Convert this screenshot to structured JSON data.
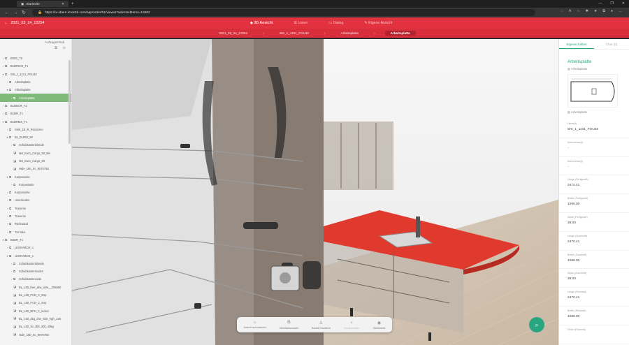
{
  "browser": {
    "tab_title": "Startseite",
    "url": "https://ix-share.imos3d.com/app/order/51/viewer?selectedItems=16582"
  },
  "app": {
    "order_label": "2021_03_24_13254",
    "views": [
      {
        "label": "3D Ansicht",
        "active": true
      },
      {
        "label": "Listen",
        "active": false
      },
      {
        "label": "Dialog",
        "active": false
      },
      {
        "label": "Eigene Ansicht",
        "active": false
      }
    ],
    "breadcrumb": [
      "2021_03_24_13254",
      "WS_1_1101_FOU40",
      "Arbeitsplatte",
      "Arbeitsplatte"
    ],
    "accent_color": "#e2313f",
    "green_color": "#29a680"
  },
  "left_panel": {
    "header": "Auftragsinhalt",
    "tree": [
      {
        "label": "B00S_79",
        "depth": 0,
        "state": "collapsed"
      },
      {
        "label": "B1DRICO_T1",
        "depth": 0,
        "state": "collapsed"
      },
      {
        "label": "WS_1_1101_FOU40",
        "depth": 0,
        "state": "expanded"
      },
      {
        "label": "Arbeitsplatte",
        "depth": 1,
        "state": "collapsed"
      },
      {
        "label": "Arbeitsplatte",
        "depth": 1,
        "state": "expanded"
      },
      {
        "label": "Arbeitsplatte",
        "depth": 2,
        "state": "selected"
      },
      {
        "label": "B1DBCR_T1",
        "depth": 0,
        "state": "collapsed"
      },
      {
        "label": "B1DR_T1",
        "depth": 0,
        "state": "collapsed"
      },
      {
        "label": "B1DRMS_T1",
        "depth": 0,
        "state": "expanded"
      },
      {
        "label": "Sink_1B_R_Rondomo",
        "depth": 1,
        "state": "collapsed"
      },
      {
        "label": "BL_EURO_90",
        "depth": 1,
        "state": "expanded"
      },
      {
        "label": "Schubkastenblende",
        "depth": 2,
        "state": "collapsed"
      },
      {
        "label": "NH_Euro_Cargo_90_Bin",
        "depth": 2,
        "state": "leaf"
      },
      {
        "label": "NH_Euro_Cargo_90",
        "depth": 2,
        "state": "leaf"
      },
      {
        "label": "Hale_180_Sc_9070750",
        "depth": 2,
        "state": "leaf"
      },
      {
        "label": "Korpusseite",
        "depth": 1,
        "state": "expanded"
      },
      {
        "label": "Korpusseite",
        "depth": 2,
        "state": "collapsed"
      },
      {
        "label": "Korpusseite",
        "depth": 1,
        "state": "collapsed"
      },
      {
        "label": "Unterboden",
        "depth": 1,
        "state": "collapsed"
      },
      {
        "label": "Traverse",
        "depth": 1,
        "state": "collapsed"
      },
      {
        "label": "Traverse",
        "depth": 1,
        "state": "collapsed"
      },
      {
        "label": "Rückwand",
        "depth": 1,
        "state": "collapsed"
      },
      {
        "label": "Tür links",
        "depth": 1,
        "state": "collapsed"
      },
      {
        "label": "B2DR_T1",
        "depth": 0,
        "state": "expanded"
      },
      {
        "label": "LEGRABOX_1",
        "depth": 1,
        "state": "collapsed"
      },
      {
        "label": "LEGRABOX_1",
        "depth": 1,
        "state": "expanded"
      },
      {
        "label": "Schubkastenblende",
        "depth": 2,
        "state": "collapsed"
      },
      {
        "label": "Schubkastenboden",
        "depth": 2,
        "state": "collapsed"
      },
      {
        "label": "Schubkastenseite",
        "depth": 2,
        "state": "collapsed"
      },
      {
        "label": "BL_L80_free_drw_side__306050",
        "depth": 2,
        "state": "leaf"
      },
      {
        "label": "BL_L80_FCD_C_Esp",
        "depth": 2,
        "state": "leaf"
      },
      {
        "label": "BL_L80_FCD_C_Esp",
        "depth": 2,
        "state": "leaf"
      },
      {
        "label": "BL_L80_BFH_C_nickel",
        "depth": 2,
        "state": "leaf"
      },
      {
        "label": "BL_L80_dsg_drw_side_hgh_128",
        "depth": 2,
        "state": "leaf"
      },
      {
        "label": "BL_L80_Sc_BM_300_40kg",
        "depth": 2,
        "state": "leaf"
      },
      {
        "label": "Hale_180_Sc_9070750",
        "depth": 2,
        "state": "leaf"
      }
    ]
  },
  "viewer_toolbar": [
    {
      "label": "Ansicht zurücksetzen",
      "icon": "home-icon",
      "disabled": false
    },
    {
      "label": "Mehrfachauswahl",
      "icon": "multi-select-icon",
      "disabled": false
    },
    {
      "label": "Bauteil-Draufsicht",
      "icon": "person-icon",
      "disabled": false
    },
    {
      "label": "Selekt.ausblen",
      "icon": "hide-icon",
      "disabled": true
    },
    {
      "label": "Sichtbarkeit",
      "icon": "eye-icon",
      "disabled": false
    }
  ],
  "right_panel": {
    "tabs": [
      {
        "label": "Eigenschaften",
        "active": true
      },
      {
        "label": "Chat (0)",
        "active": false
      }
    ],
    "title": "Arbeitsplatte",
    "image_alt_1": "Arbeitsplatte",
    "image_alt_2": "Arbeitsplatte",
    "properties": [
      {
        "key": "Name(t)",
        "value": "WS_1_1101_FOU40"
      },
      {
        "key": "Kommentar(t)",
        "value": "-"
      },
      {
        "key": "Kommentar(t)",
        "value": "-"
      },
      {
        "key": "Länge (Fertigmaß)",
        "value": "2472.41"
      },
      {
        "key": "Breite (Fertigmaß)",
        "value": "1090.00"
      },
      {
        "key": "Dicke (Fertigmaß)",
        "value": "38.00"
      },
      {
        "key": "Länge (Zuschnitt)",
        "value": "2470.41"
      },
      {
        "key": "Breite (Zuschnitt)",
        "value": "1088.00"
      },
      {
        "key": "Dicke (Zuschnitt)",
        "value": "38.00"
      },
      {
        "key": "Länge (Rohmaß)",
        "value": "2470.41"
      },
      {
        "key": "Breite (Rohmaß)",
        "value": "1088.00"
      },
      {
        "key": "Dicke (Rohmaß)",
        "value": ""
      }
    ]
  }
}
